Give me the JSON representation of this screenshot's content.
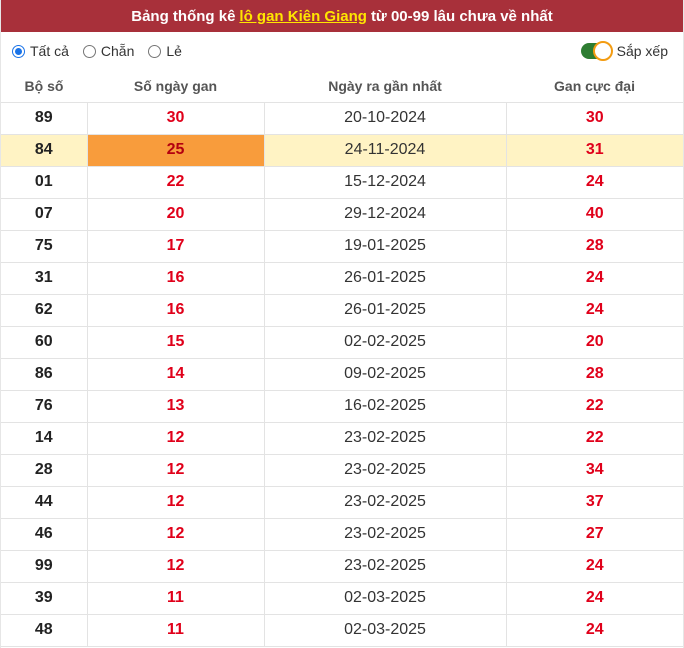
{
  "header": {
    "title_prefix": "Bảng thống kê",
    "title_link": "lô gan Kiên Giang",
    "title_suffix": "từ 00-99 lâu chưa về nhất"
  },
  "filters": {
    "options": [
      {
        "label": "Tất cả",
        "checked": true
      },
      {
        "label": "Chẵn",
        "checked": false
      },
      {
        "label": "Lẻ",
        "checked": false
      }
    ],
    "sort_label": "Sắp xếp",
    "sort_on": true
  },
  "table": {
    "columns": [
      "Bộ số",
      "Số ngày gan",
      "Ngày ra gần nhất",
      "Gan cực đại"
    ],
    "highlight_row": 1,
    "rows": [
      [
        "89",
        "30",
        "20-10-2024",
        "30"
      ],
      [
        "84",
        "25",
        "24-11-2024",
        "31"
      ],
      [
        "01",
        "22",
        "15-12-2024",
        "24"
      ],
      [
        "07",
        "20",
        "29-12-2024",
        "40"
      ],
      [
        "75",
        "17",
        "19-01-2025",
        "28"
      ],
      [
        "31",
        "16",
        "26-01-2025",
        "24"
      ],
      [
        "62",
        "16",
        "26-01-2025",
        "24"
      ],
      [
        "60",
        "15",
        "02-02-2025",
        "20"
      ],
      [
        "86",
        "14",
        "09-02-2025",
        "28"
      ],
      [
        "76",
        "13",
        "16-02-2025",
        "22"
      ],
      [
        "14",
        "12",
        "23-02-2025",
        "22"
      ],
      [
        "28",
        "12",
        "23-02-2025",
        "34"
      ],
      [
        "44",
        "12",
        "23-02-2025",
        "37"
      ],
      [
        "46",
        "12",
        "23-02-2025",
        "27"
      ],
      [
        "99",
        "12",
        "23-02-2025",
        "24"
      ],
      [
        "39",
        "11",
        "02-03-2025",
        "24"
      ],
      [
        "48",
        "11",
        "02-03-2025",
        "24"
      ]
    ]
  },
  "colors": {
    "title_bg": "#a8303a",
    "title_link": "#ffe600",
    "value_red": "#e0001a",
    "highlight_row_bg": "#fff3c4",
    "highlight_cell_bg": "#f89c3c",
    "toggle_on": "#2e7d32"
  }
}
